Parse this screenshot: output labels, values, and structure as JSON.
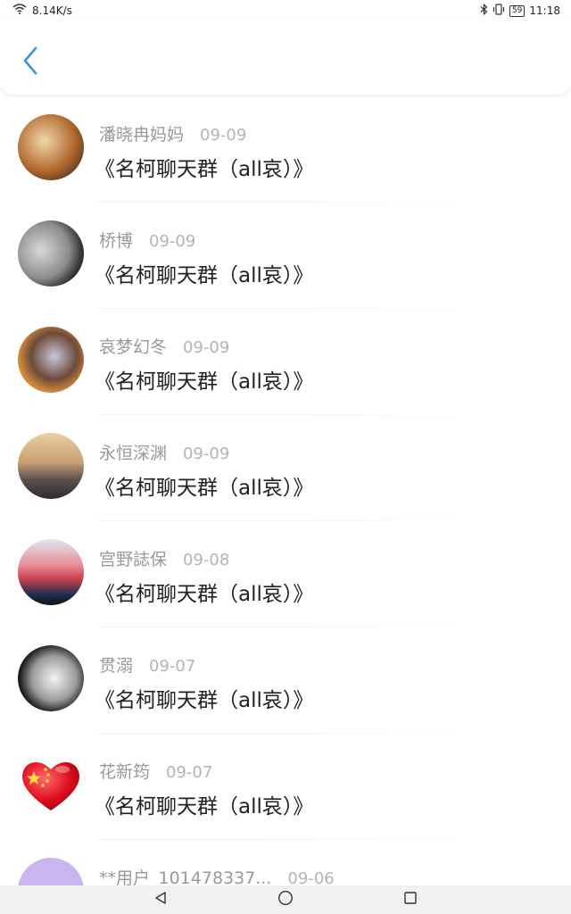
{
  "status_bar": {
    "network_speed": "8.14K/s",
    "battery": "59",
    "time": "11:18",
    "icons": [
      "wifi-icon",
      "bluetooth-icon",
      "vibrate-icon",
      "battery-icon"
    ]
  },
  "header": {
    "back_icon": "chevron-left-icon",
    "accent_color": "#2a9be0"
  },
  "items": [
    {
      "name": "潘晓冉妈妈",
      "date": "09-09",
      "message": "《名柯聊天群（all哀）》"
    },
    {
      "name": "桥博",
      "date": "09-09",
      "message": "《名柯聊天群（all哀）》"
    },
    {
      "name": "哀梦幻冬",
      "date": "09-09",
      "message": "《名柯聊天群（all哀）》"
    },
    {
      "name": "永恒深渊",
      "date": "09-09",
      "message": "《名柯聊天群（all哀）》"
    },
    {
      "name": "宫野誌保",
      "date": "09-08",
      "message": "《名柯聊天群（all哀）》"
    },
    {
      "name": "贯溺",
      "date": "09-07",
      "message": "《名柯聊天群（all哀）》"
    },
    {
      "name": "花新筠",
      "date": "09-07",
      "message": "《名柯聊天群（all哀）》"
    },
    {
      "name": "**用户_101478337...",
      "date": "09-06",
      "message": ""
    }
  ],
  "nav_bar": {
    "icons": [
      "back-triangle-icon",
      "home-circle-icon",
      "recents-square-icon"
    ]
  }
}
